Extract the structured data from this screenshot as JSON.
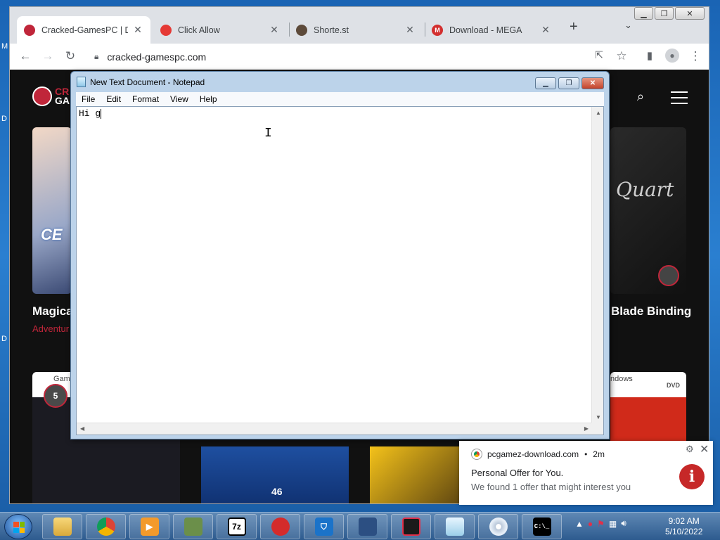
{
  "desktop": {
    "edge_labels": [
      "M",
      "D",
      "D"
    ]
  },
  "browser": {
    "tabs": [
      {
        "title": "Cracked-GamesPC | Dov",
        "active": true,
        "favicon_color": "#c0263a"
      },
      {
        "title": "Click Allow",
        "active": false,
        "favicon_color": "#e53935"
      },
      {
        "title": "Shorte.st",
        "active": false,
        "favicon_color": "#5d4a3a"
      },
      {
        "title": "Download - MEGA",
        "active": false,
        "favicon_color": "#d32f2f"
      }
    ],
    "new_tab": "+",
    "url": "cracked-gamespc.com"
  },
  "site": {
    "logo_line1": "CR",
    "logo_line2": "GA",
    "cards": [
      {
        "title": "Magical",
        "genre": "Adventur",
        "overlay": "CE"
      },
      {
        "title": "Blade Binding",
        "overlay": "Quart"
      }
    ],
    "bottom_cards": [
      {
        "label": "Gam",
        "badge": "5"
      },
      {
        "label": "ndows",
        "extra": "DVD"
      }
    ],
    "kart_number": "46",
    "colors": {
      "accent": "#c0263a",
      "background": "#111111"
    }
  },
  "notepad": {
    "title": "New Text Document - Notepad",
    "menu": [
      "File",
      "Edit",
      "Format",
      "View",
      "Help"
    ],
    "content": "Hi g"
  },
  "notification": {
    "source": "pcgamez-download.com",
    "time": "2m",
    "title": "Personal Offer for You.",
    "body": "We found 1 offer that might interest you"
  },
  "taskbar": {
    "apps": [
      {
        "name": "file-explorer-icon"
      },
      {
        "name": "chrome-icon"
      },
      {
        "name": "media-player-icon"
      },
      {
        "name": "task-manager-icon"
      },
      {
        "name": "7zip-icon",
        "label": "7z"
      },
      {
        "name": "red-app-icon"
      },
      {
        "name": "vpn-shield-icon"
      },
      {
        "name": "image-app-icon"
      },
      {
        "name": "recorder-icon"
      },
      {
        "name": "notepad-icon"
      },
      {
        "name": "disc-icon"
      },
      {
        "name": "cmd-icon",
        "label": "C:\\_"
      }
    ],
    "time": "9:02 AM",
    "date": "5/10/2022"
  }
}
